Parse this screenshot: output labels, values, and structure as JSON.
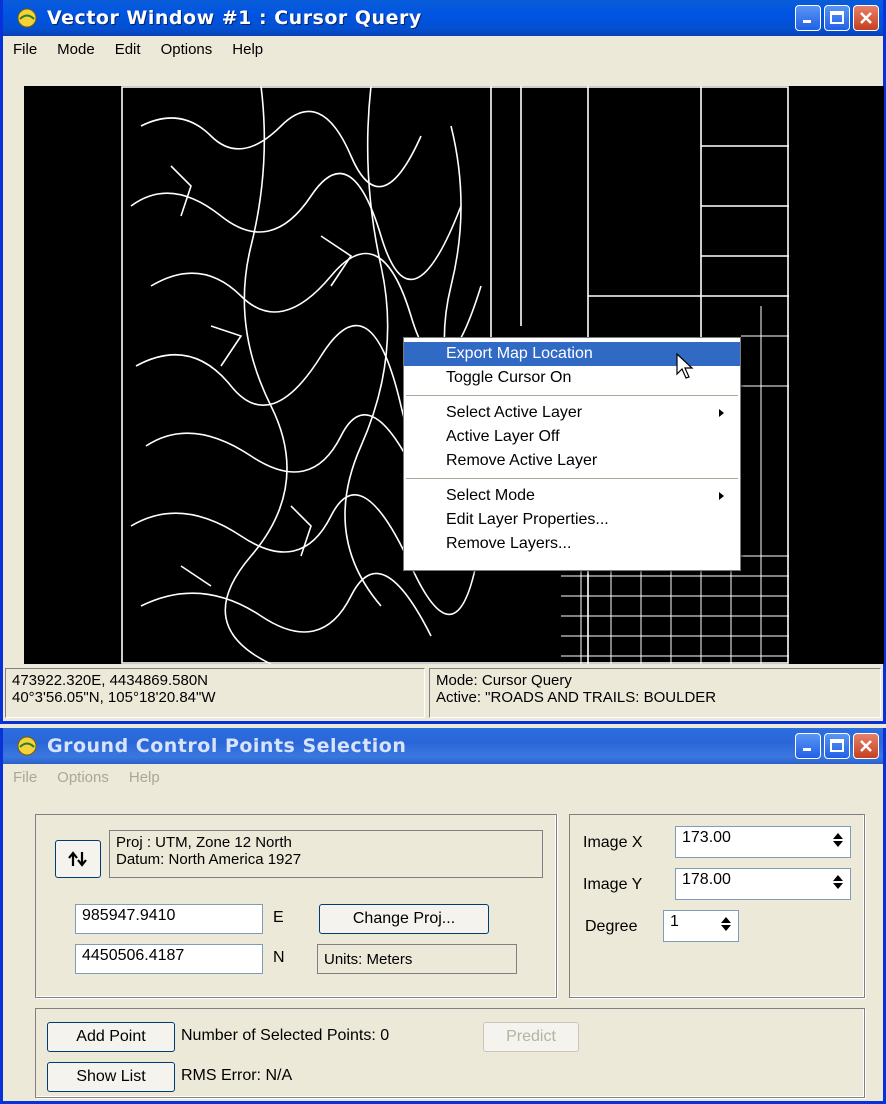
{
  "vector_window": {
    "title": "Vector Window #1 : Cursor Query",
    "menu": [
      "File",
      "Mode",
      "Edit",
      "Options",
      "Help"
    ],
    "status_left": [
      "473922.320E, 4434869.580N",
      "40°3'56.05\"N, 105°18'20.84\"W"
    ],
    "status_right": [
      "Mode: Cursor Query",
      "Active: \"ROADS AND TRAILS: BOULDER"
    ]
  },
  "context_menu": {
    "items": [
      {
        "label": "Export Map Location",
        "highlighted": true,
        "submenu": false
      },
      {
        "label": "Toggle Cursor On",
        "highlighted": false,
        "submenu": false
      },
      {
        "label": "Select Active Layer",
        "highlighted": false,
        "submenu": true
      },
      {
        "label": "Active Layer Off",
        "highlighted": false,
        "submenu": false
      },
      {
        "label": "Remove Active Layer",
        "highlighted": false,
        "submenu": false
      },
      {
        "label": "Select Mode",
        "highlighted": false,
        "submenu": true
      },
      {
        "label": "Edit Layer Properties...",
        "highlighted": false,
        "submenu": false
      },
      {
        "label": "Remove Layers...",
        "highlighted": false,
        "submenu": false
      }
    ]
  },
  "gcp_window": {
    "title": "Ground Control Points Selection",
    "menu": [
      "File",
      "Options",
      "Help"
    ],
    "proj_lines": [
      "Proj : UTM, Zone 12 North",
      "Datum: North America 1927"
    ],
    "easting": "985947.9410",
    "easting_unit": "E",
    "northing": "4450506.4187",
    "northing_unit": "N",
    "change_proj": "Change Proj...",
    "units": "Units: Meters",
    "image_x_label": "Image X",
    "image_x": "173.00",
    "image_y_label": "Image Y",
    "image_y": "178.00",
    "degree_label": "Degree",
    "degree": "1",
    "add_point": "Add Point",
    "selected_points": "Number of Selected Points: 0",
    "predict": "Predict",
    "show_list": "Show List",
    "rms_error": "RMS Error: N/A"
  },
  "colors": {
    "titlebar": "#0054e3",
    "highlight": "#316ac5",
    "window_bg": "#ece9d8"
  }
}
